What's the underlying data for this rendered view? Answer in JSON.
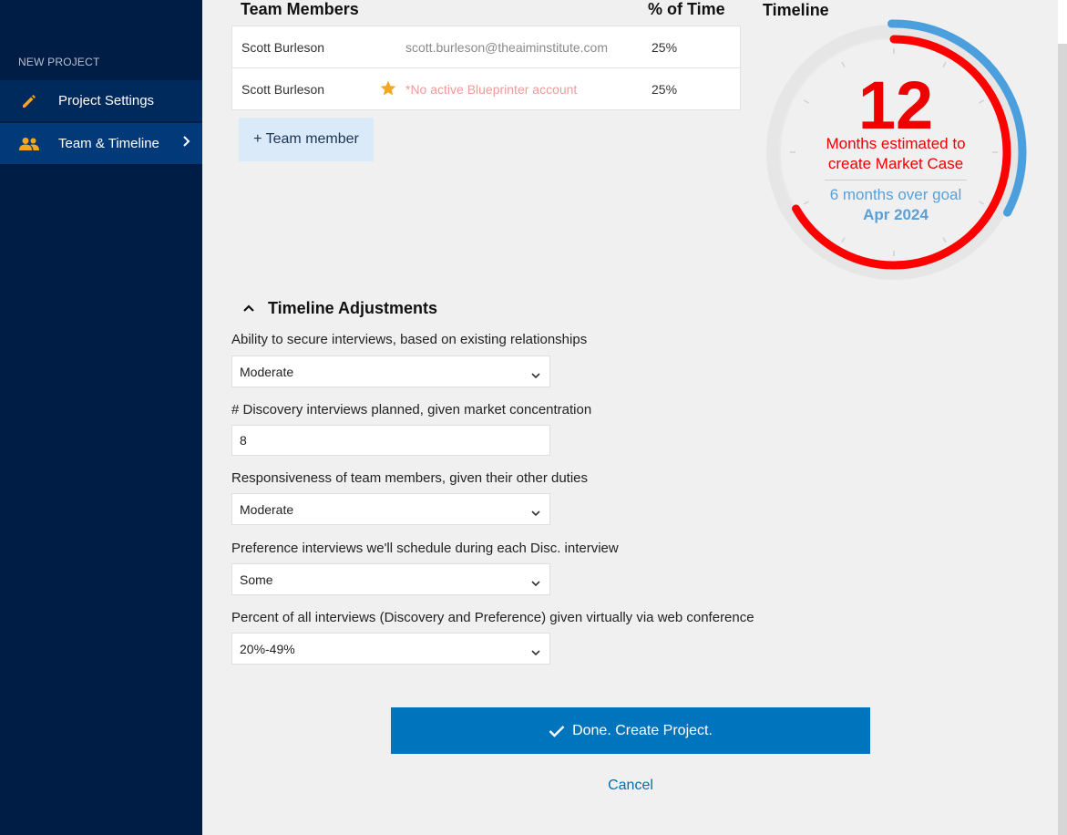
{
  "sidebar": {
    "section_label": "NEW PROJECT",
    "items": [
      {
        "label": "Project Settings",
        "icon": "pencil-icon"
      },
      {
        "label": "Team & Timeline",
        "icon": "people-icon"
      }
    ]
  },
  "team": {
    "header_members": "Team Members",
    "header_time": "% of Time",
    "rows": [
      {
        "name": "Scott Burleson",
        "email": "scott.burleson@theaiminstitute.com",
        "percent": "25%"
      },
      {
        "name": "Scott Burleson",
        "warning": "*No active Blueprinter account",
        "percent": "25%"
      }
    ],
    "add_button": "+ Team member"
  },
  "timeline": {
    "title": "Timeline",
    "months": "12",
    "months_label_1": "Months estimated to",
    "months_label_2": "create Market Case",
    "over_goal": "6 months over goal",
    "date": "Apr 2024"
  },
  "adjustments": {
    "title": "Timeline Adjustments",
    "fields": [
      {
        "label": "Ability to secure interviews, based on existing relationships",
        "value": "Moderate"
      },
      {
        "label": "# Discovery interviews planned, given market concentration",
        "value": "8"
      },
      {
        "label": "Responsiveness of team members, given their other duties",
        "value": "Moderate"
      },
      {
        "label": "Preference interviews we'll schedule during each Disc. interview",
        "value": "Some"
      },
      {
        "label": "Percent of all interviews (Discovery and Preference) given virtually via web conference",
        "value": "20%-49%"
      }
    ]
  },
  "actions": {
    "done": "Done. Create Project.",
    "cancel": "Cancel"
  },
  "colors": {
    "sidebar_bg": "#001d45",
    "accent_red": "#ee0000",
    "accent_blue": "#5aa0d8",
    "primary_button": "#0075bd"
  }
}
